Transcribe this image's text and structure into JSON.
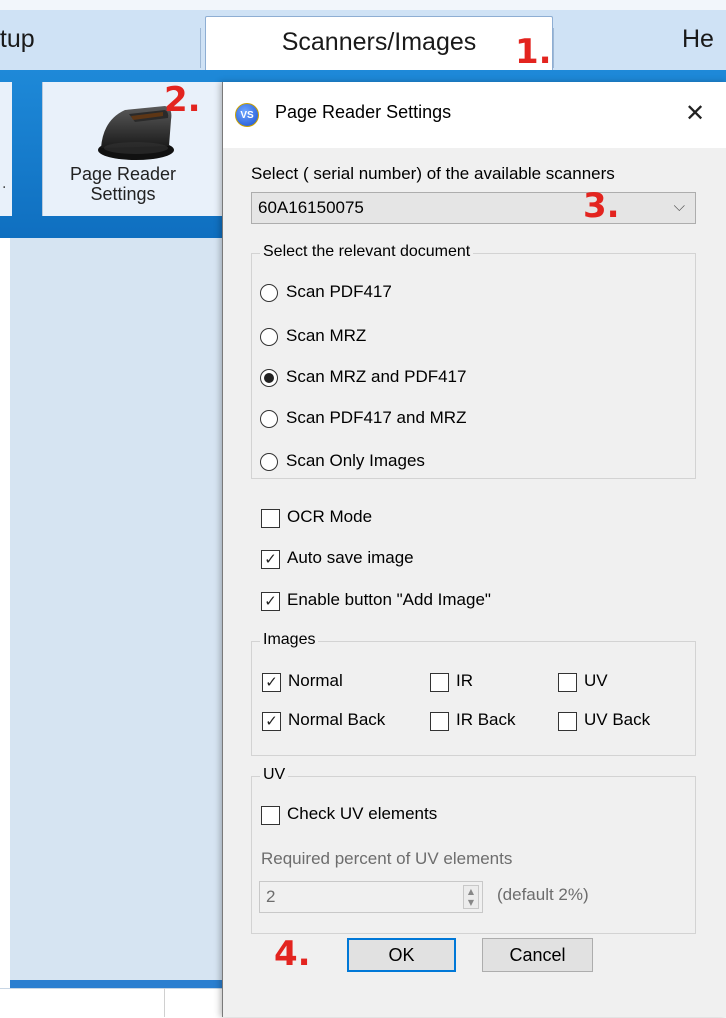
{
  "app": {
    "tabs": [
      {
        "label": "etup"
      },
      {
        "label": "Scanners/Images"
      },
      {
        "label": "He"
      }
    ],
    "ribbon": {
      "page_reader_label_1": "Page Reader",
      "page_reader_label_2": "Settings",
      "left_fragment": "."
    }
  },
  "dialog": {
    "title": "Page Reader Settings",
    "logo_text": "VS",
    "close_glyph": "✕",
    "scanner_select": {
      "label": "Select ( serial number) of  the available scanners",
      "value": "60A16150075",
      "arrow": "⌵"
    },
    "document_group": {
      "title": "Select the relevant document",
      "options": [
        {
          "label": "Scan PDF417",
          "selected": false
        },
        {
          "label": "Scan MRZ",
          "selected": false
        },
        {
          "label": "Scan MRZ and PDF417",
          "selected": true
        },
        {
          "label": "Scan PDF417 and MRZ",
          "selected": false
        },
        {
          "label": "Scan Only Images",
          "selected": false
        }
      ]
    },
    "checks": [
      {
        "label": "OCR Mode",
        "checked": false
      },
      {
        "label": "Auto save image",
        "checked": true
      },
      {
        "label": "Enable button \"Add Image\"",
        "checked": true
      }
    ],
    "images_group": {
      "title": "Images",
      "items": [
        {
          "label": "Normal",
          "checked": true
        },
        {
          "label": "IR",
          "checked": false
        },
        {
          "label": "UV",
          "checked": false
        },
        {
          "label": "Normal Back",
          "checked": true
        },
        {
          "label": "IR Back",
          "checked": false
        },
        {
          "label": "UV Back",
          "checked": false
        }
      ]
    },
    "uv_group": {
      "title": "UV",
      "check_label": "Check UV elements",
      "check_checked": false,
      "percent_label": "Required percent of UV elements",
      "percent_value": "2",
      "default_note": "(default 2%)"
    },
    "buttons": {
      "ok": "OK",
      "cancel": "Cancel"
    }
  },
  "annotations": {
    "step1": "1.",
    "step2": "2.",
    "step3": "3.",
    "step4": "4.",
    "color": "#e3241f"
  },
  "check_glyph": "✓"
}
